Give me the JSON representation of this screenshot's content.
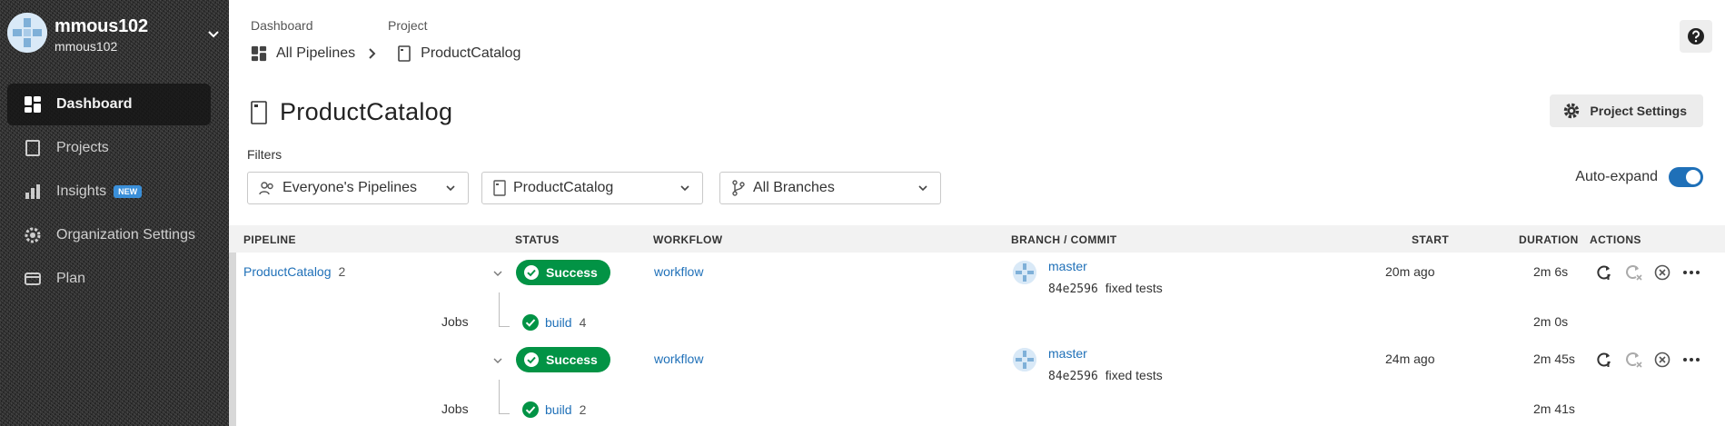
{
  "sidebar": {
    "user": {
      "name": "mmous102",
      "sub": "mmous102"
    },
    "items": [
      {
        "label": "Dashboard",
        "icon": "dashboard-icon",
        "active": true
      },
      {
        "label": "Projects",
        "icon": "projects-icon"
      },
      {
        "label": "Insights",
        "icon": "insights-icon",
        "badge": "NEW"
      },
      {
        "label": "Organization Settings",
        "icon": "settings-icon"
      },
      {
        "label": "Plan",
        "icon": "plan-icon"
      }
    ]
  },
  "breadcrumb": {
    "label_dashboard": "Dashboard",
    "label_project": "Project",
    "all_pipelines": "All Pipelines",
    "project": "ProductCatalog"
  },
  "header": {
    "title": "ProductCatalog",
    "settings_label": "Project Settings"
  },
  "filters": {
    "label": "Filters",
    "pipelines": "Everyone's Pipelines",
    "project": "ProductCatalog",
    "branches": "All Branches",
    "auto_expand": "Auto-expand",
    "auto_expand_on": true
  },
  "table": {
    "columns": {
      "pipeline": "PIPELINE",
      "status": "STATUS",
      "workflow": "WORKFLOW",
      "branch": "BRANCH / COMMIT",
      "start": "START",
      "duration": "DURATION",
      "actions": "ACTIONS"
    },
    "project_name": "ProductCatalog",
    "pipeline_number": "2",
    "jobs_label": "Jobs",
    "workflows": [
      {
        "status": "Success",
        "workflow": "workflow",
        "branch": "master",
        "commit": "84e2596",
        "commit_msg": "fixed tests",
        "start": "20m ago",
        "duration": "2m 6s",
        "job": {
          "name": "build",
          "number": "4",
          "duration": "2m 0s"
        }
      },
      {
        "status": "Success",
        "workflow": "workflow",
        "branch": "master",
        "commit": "84e2596",
        "commit_msg": "fixed tests",
        "start": "24m ago",
        "duration": "2m 45s",
        "job": {
          "name": "build",
          "number": "2",
          "duration": "2m 41s"
        }
      }
    ]
  },
  "colors": {
    "success": "#029345",
    "link": "#1f70b8",
    "sidebar": "#2b2b2b"
  }
}
